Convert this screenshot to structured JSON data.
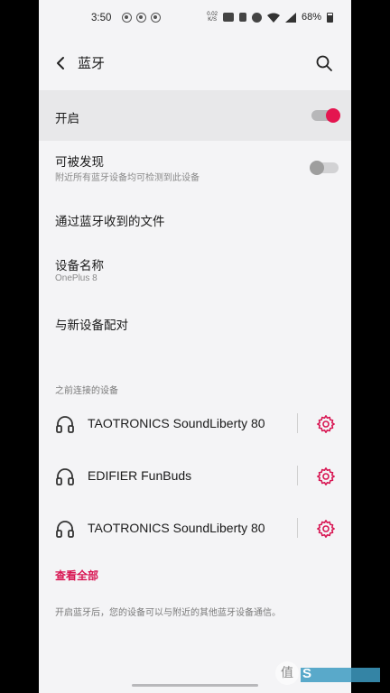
{
  "status_bar": {
    "time": "3:50",
    "speed_line1": "0.02",
    "speed_line2": "K/S",
    "battery": "68%"
  },
  "header": {
    "title": "蓝牙",
    "back_icon": "chevron-left-icon",
    "search_icon": "search-icon"
  },
  "settings": {
    "bluetooth": {
      "label": "开启",
      "enabled": true
    },
    "discoverable": {
      "label": "可被发现",
      "subtitle": "附近所有蓝牙设备均可检测到此设备",
      "enabled": false
    },
    "received_files": {
      "label": "通过蓝牙收到的文件"
    },
    "device_name": {
      "label": "设备名称",
      "value": "OnePlus 8"
    },
    "pair_new": {
      "label": "与新设备配对"
    }
  },
  "previous_devices": {
    "header": "之前连接的设备",
    "items": [
      {
        "name": "TAOTRONICS SoundLiberty 80",
        "icon": "headphones-icon"
      },
      {
        "name": "EDIFIER FunBuds",
        "icon": "headphones-icon"
      },
      {
        "name": "TAOTRONICS SoundLiberty 80",
        "icon": "headphones-icon"
      }
    ],
    "see_all": "查看全部"
  },
  "footer_note": "开启蓝牙后，您的设备可以与附近的其他蓝牙设备通信。",
  "watermark": {
    "glyph": "值",
    "letter": "S"
  },
  "colors": {
    "accent": "#e4154f",
    "see_all": "#d81552",
    "background": "#f4f4f6",
    "highlight_row": "#e8e8ea"
  }
}
